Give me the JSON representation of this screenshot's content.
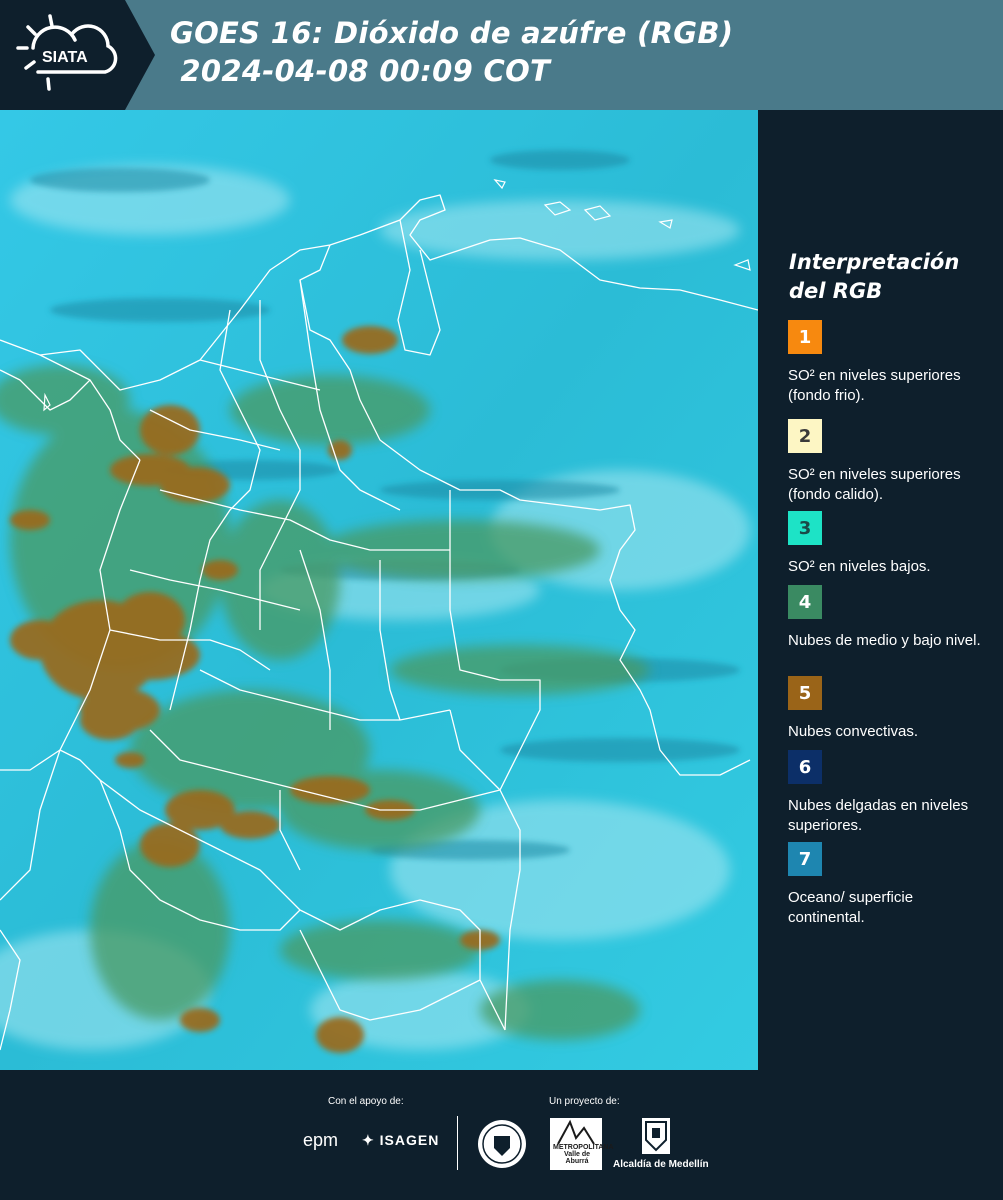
{
  "header": {
    "logo_text": "SIATA",
    "title_line1": "GOES 16: Dióxido de azúfre (RGB)",
    "title_line2": " 2024-04-08 00:09 COT"
  },
  "legend": {
    "title": "Interpretación del RGB",
    "items": [
      {
        "number": "1",
        "color": "#f7890f",
        "label": "SO² en niveles superiores (fondo frio)."
      },
      {
        "number": "2",
        "color": "#fdf6c4",
        "label": "SO² en niveles superiores (fondo calido)."
      },
      {
        "number": "3",
        "color": "#1de3c6",
        "label": "SO² en niveles bajos."
      },
      {
        "number": "4",
        "color": "#3a8a62",
        "label": "Nubes de medio y bajo nivel."
      },
      {
        "number": "5",
        "color": "#9a6418",
        "label": "Nubes convectivas."
      },
      {
        "number": "6",
        "color": "#0c2f68",
        "label": "Nubes delgadas en niveles superiores."
      },
      {
        "number": "7",
        "color": "#1e86b0",
        "label": "Oceano/ superficie continental."
      }
    ]
  },
  "footer": {
    "support_label": "Con el apoyo de:",
    "project_label": "Un proyecto de:",
    "epm": "epm",
    "isagen": "ISAGEN",
    "area_text": "METROPOLITANA Valle de Aburrá",
    "alcaldia": "Alcaldía de Medellín"
  },
  "colors": {
    "header_bg": "#4a7a8a",
    "panel_bg": "#0e1f2c",
    "map_base": "#2fc5e0",
    "cloud_convective": "#9a6418",
    "cloud_mid": "#3a8a62"
  },
  "icons": [
    "siata-sun-cloud-icon",
    "isagen-star-icon",
    "medellin-seal-icon",
    "alcaldia-crest-icon"
  ]
}
